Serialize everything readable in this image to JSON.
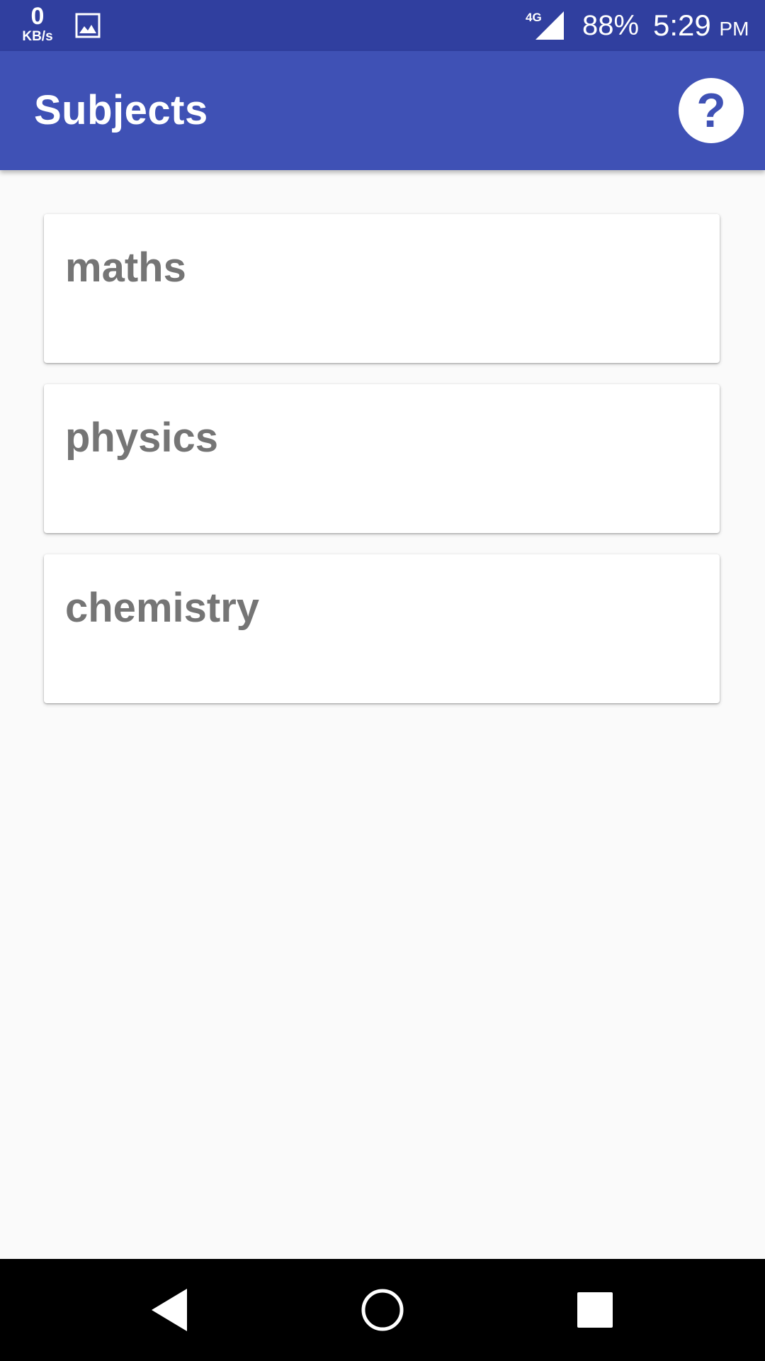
{
  "status_bar": {
    "net_speed_value": "0",
    "net_speed_unit": "KB/s",
    "gallery_icon": "image-icon",
    "network_label": "4G",
    "signal_icon": "cell-signal-icon",
    "battery": "88%",
    "time": "5:29",
    "ampm": "PM"
  },
  "app_bar": {
    "title": "Subjects",
    "help_label": "?",
    "help_icon": "help-icon"
  },
  "subjects": [
    {
      "name": "maths"
    },
    {
      "name": "physics"
    },
    {
      "name": "chemistry"
    }
  ],
  "nav_bar": {
    "back_icon": "back-triangle-icon",
    "home_icon": "home-circle-icon",
    "recents_icon": "recents-square-icon"
  },
  "colors": {
    "status_bar": "#303f9f",
    "app_bar": "#3f51b5",
    "background": "#fafafa",
    "card_text": "#757575",
    "nav_bar": "#000000"
  }
}
